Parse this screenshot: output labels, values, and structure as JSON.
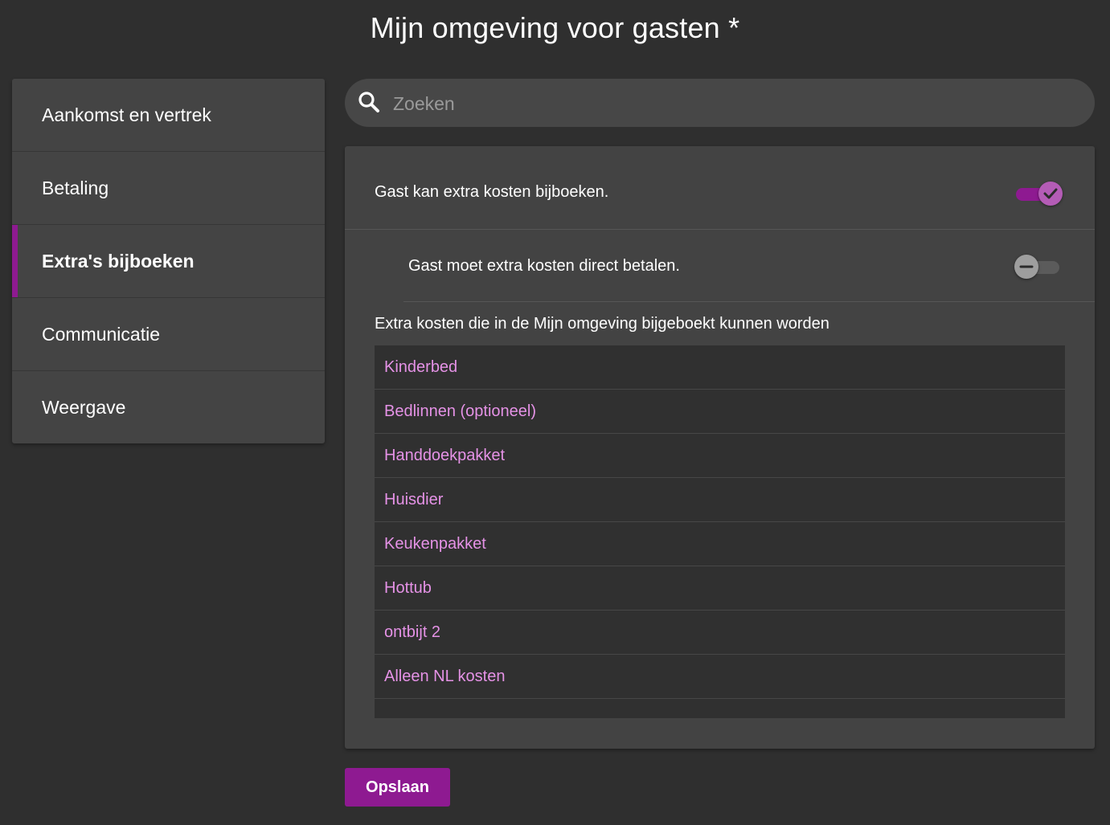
{
  "page": {
    "title": "Mijn omgeving voor gasten *"
  },
  "sidebar": {
    "items": [
      {
        "label": "Aankomst en vertrek",
        "active": false
      },
      {
        "label": "Betaling",
        "active": false
      },
      {
        "label": "Extra's bijboeken",
        "active": true
      },
      {
        "label": "Communicatie",
        "active": false
      },
      {
        "label": "Weergave",
        "active": false
      }
    ]
  },
  "search": {
    "placeholder": "Zoeken",
    "value": "",
    "icon": "search-icon"
  },
  "settings": {
    "can_book_extra": {
      "label": "Gast kan extra kosten bijboeken.",
      "enabled": true
    },
    "must_pay_direct": {
      "label": "Gast moet extra kosten direct betalen.",
      "enabled": false
    }
  },
  "extras": {
    "title": "Extra kosten die in de Mijn omgeving bijgeboekt kunnen worden",
    "items": [
      "Kinderbed",
      "Bedlinnen (optioneel)",
      "Handdoekpakket",
      "Huisdier",
      "Keukenpakket",
      "Hottub",
      "ontbijt 2",
      "Alleen NL kosten"
    ]
  },
  "actions": {
    "save_label": "Opslaan"
  },
  "colors": {
    "accent": "#8e1a91",
    "link": "#e592e6",
    "background": "#2f2f2f",
    "panel": "#434343"
  }
}
